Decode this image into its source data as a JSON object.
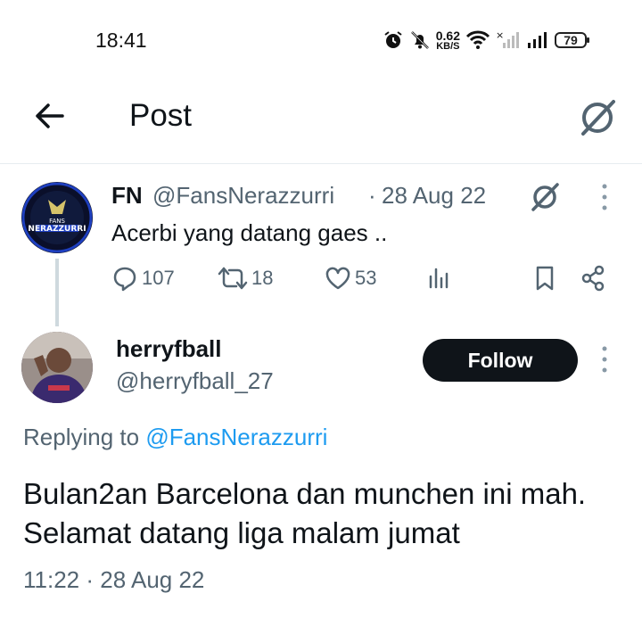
{
  "status_bar": {
    "time": "18:41",
    "net_speed_value": "0.62",
    "net_speed_unit": "KB/S",
    "battery": "79",
    "icons": [
      "alarm-icon",
      "mute-icon",
      "wifi-icon",
      "signal-icon",
      "signal-icon",
      "battery-icon"
    ]
  },
  "header": {
    "title": "Post",
    "back_icon": "back-arrow-icon",
    "grok_icon": "grok-icon"
  },
  "parent_tweet": {
    "name": "FN",
    "handle": "@FansNerazzurri",
    "separator": "·",
    "date": "28 Aug 22",
    "text": "Acerbi yang datang gaes ..",
    "avatar_text": "FANS NERAZZURRI",
    "actions": {
      "replies": "107",
      "reposts": "18",
      "likes": "53"
    }
  },
  "reply_tweet": {
    "name": "herryfball",
    "handle": "@herryfball_27",
    "follow_label": "Follow",
    "replying_prefix": "Replying to",
    "replying_to": "@FansNerazzurri",
    "text": "Bulan2an Barcelona dan munchen ini mah. Selamat datang liga malam jumat",
    "time": "11:22",
    "separator": "·",
    "date": "28 Aug 22"
  },
  "colors": {
    "text_primary": "#0f1419",
    "text_secondary": "#536471",
    "link": "#1d9bf0",
    "divider": "#e6ecf0"
  }
}
